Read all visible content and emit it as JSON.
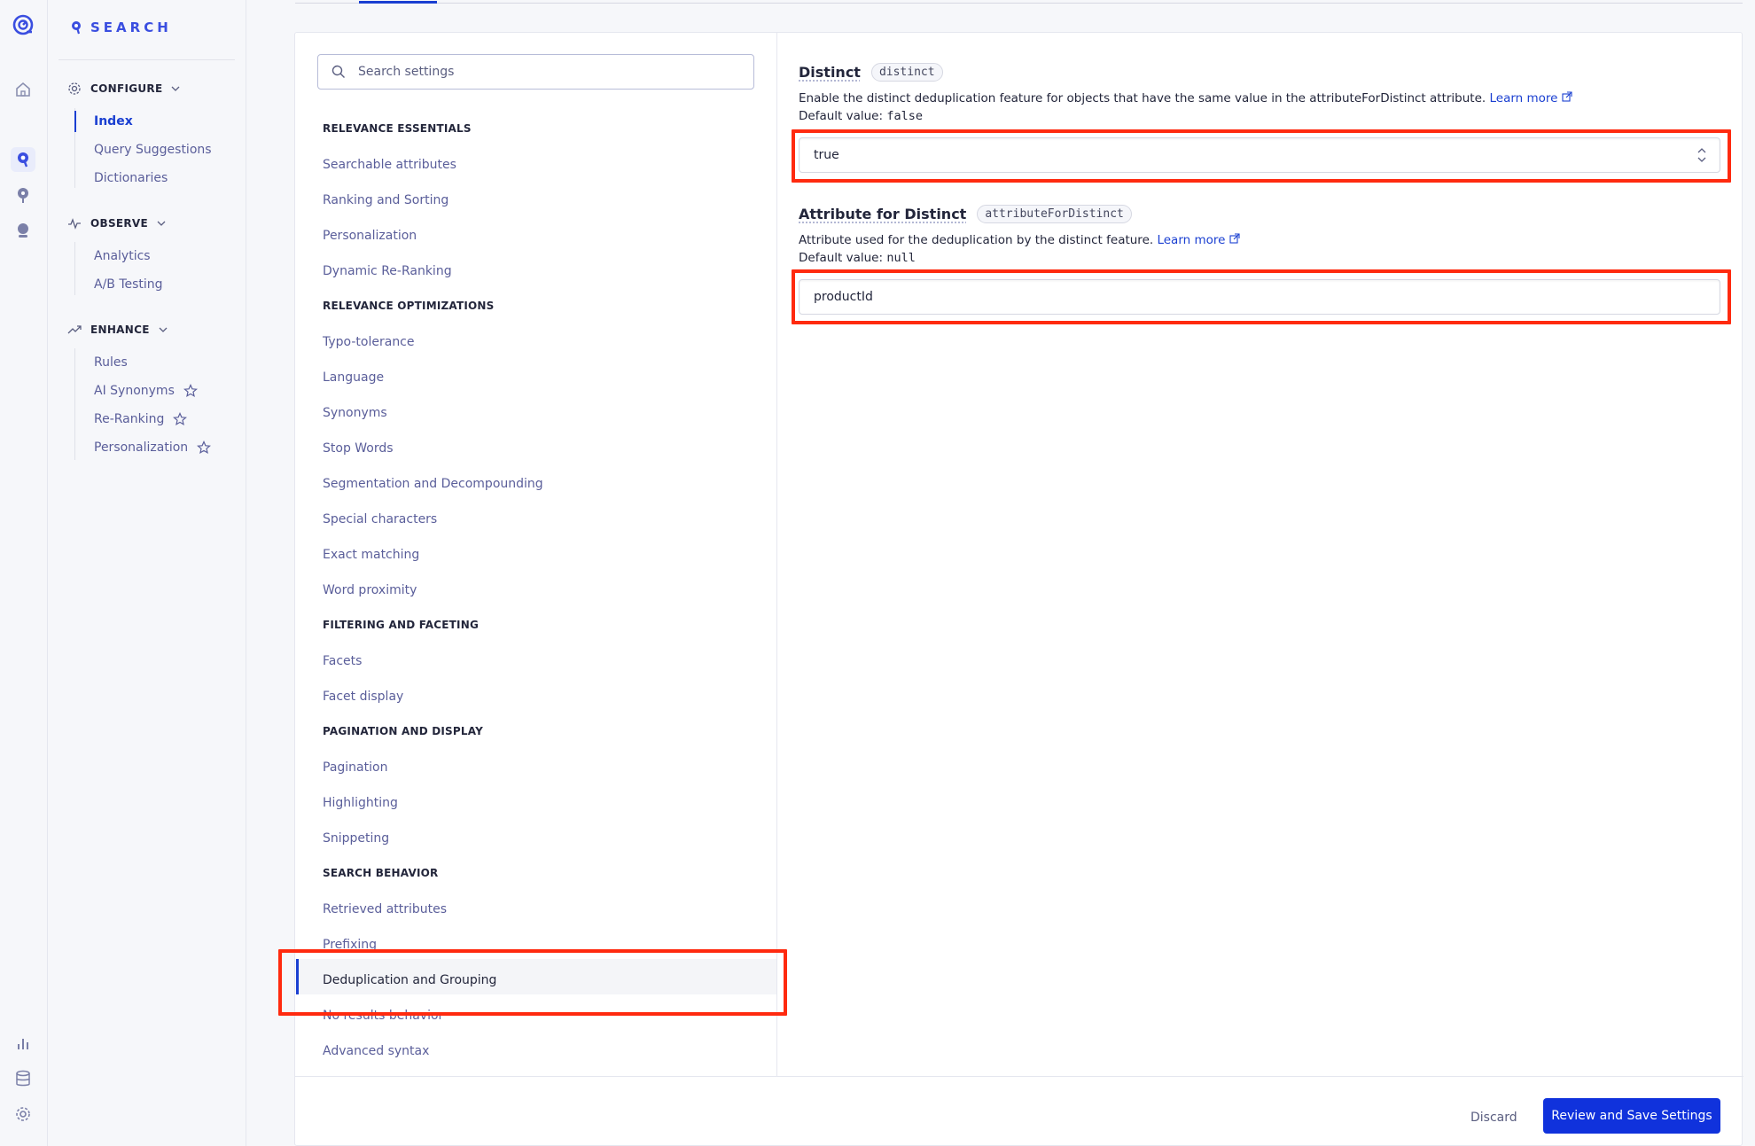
{
  "brand": {
    "name": "SEARCH",
    "accent": "#3a4ee0"
  },
  "rail_icons": [
    "algolia-logo-icon",
    "home-icon",
    "search-product-icon",
    "recommend-icon",
    "generative-icon",
    "analytics-bars-icon",
    "database-icon",
    "settings-gear-icon"
  ],
  "sidebar": {
    "configure": {
      "label": "CONFIGURE",
      "items": [
        "Index",
        "Query Suggestions",
        "Dictionaries"
      ],
      "active": "Index"
    },
    "observe": {
      "label": "OBSERVE",
      "items": [
        "Analytics",
        "A/B Testing"
      ]
    },
    "enhance": {
      "label": "ENHANCE",
      "items": [
        "Rules",
        "AI Synonyms",
        "Re-Ranking",
        "Personalization"
      ]
    }
  },
  "settings_search": {
    "placeholder": "Search settings"
  },
  "categories": {
    "relevance_essentials": {
      "label": "RELEVANCE ESSENTIALS",
      "items": [
        "Searchable attributes",
        "Ranking and Sorting",
        "Personalization",
        "Dynamic Re-Ranking"
      ]
    },
    "relevance_optimizations": {
      "label": "RELEVANCE OPTIMIZATIONS",
      "items": [
        "Typo-tolerance",
        "Language",
        "Synonyms",
        "Stop Words",
        "Segmentation and Decompounding",
        "Special characters",
        "Exact matching",
        "Word proximity"
      ]
    },
    "filtering_faceting": {
      "label": "FILTERING AND FACETING",
      "items": [
        "Facets",
        "Facet display"
      ]
    },
    "pagination_display": {
      "label": "PAGINATION AND DISPLAY",
      "items": [
        "Pagination",
        "Highlighting",
        "Snippeting"
      ]
    },
    "search_behavior": {
      "label": "SEARCH BEHAVIOR",
      "items": [
        "Retrieved attributes",
        "Prefixing",
        "Deduplication and Grouping",
        "No results behavior",
        "Advanced syntax"
      ],
      "selected": "Deduplication and Grouping"
    }
  },
  "distinct": {
    "title": "Distinct",
    "code": "distinct",
    "description": "Enable the distinct deduplication feature for objects that have the same value in the attributeForDistinct attribute.",
    "learn_more": "Learn more",
    "default_label": "Default value:",
    "default_value": "false",
    "value": "true"
  },
  "attribute_for_distinct": {
    "title": "Attribute for Distinct",
    "code": "attributeForDistinct",
    "description": "Attribute used for the deduplication by the distinct feature.",
    "learn_more": "Learn more",
    "default_label": "Default value:",
    "default_value": "null",
    "value": "productId"
  },
  "footer": {
    "discard": "Discard",
    "save": "Review and Save Settings"
  },
  "colors": {
    "primary": "#1032dc",
    "highlight": "#ff2a0f"
  }
}
